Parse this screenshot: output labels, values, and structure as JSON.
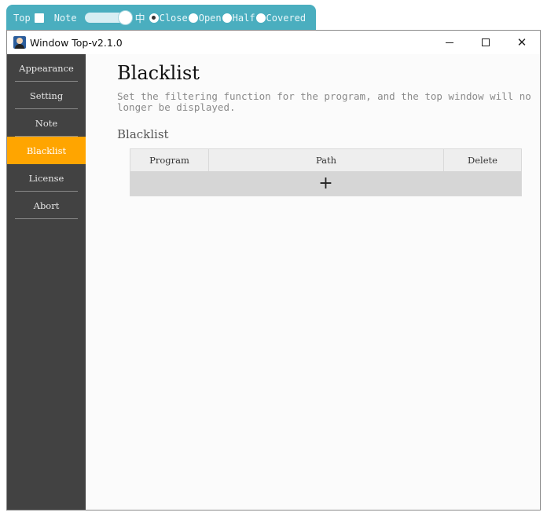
{
  "toolbar": {
    "top_label": "Top",
    "note_label": "Note",
    "lang_label": "中",
    "options": [
      {
        "label": "Close",
        "selected": true
      },
      {
        "label": "Open",
        "selected": false
      },
      {
        "label": "Half",
        "selected": false
      },
      {
        "label": "Covered",
        "selected": false
      }
    ]
  },
  "window": {
    "title": "Window Top-v2.1.0",
    "controls": {
      "minimize": "minimize",
      "maximize": "maximize",
      "close": "✕"
    }
  },
  "sidebar": {
    "items": [
      {
        "label": "Appearance",
        "active": false
      },
      {
        "label": "Setting",
        "active": false
      },
      {
        "label": "Note",
        "active": false
      },
      {
        "label": "Blacklist",
        "active": true
      },
      {
        "label": "License",
        "active": false
      },
      {
        "label": "Abort",
        "active": false
      }
    ]
  },
  "main": {
    "title": "Blacklist",
    "description": "Set the filtering function for the program, and the top window will no longer be displayed.",
    "section_title": "Blacklist",
    "table": {
      "columns": [
        "Program",
        "Path",
        "Delete"
      ],
      "rows": [],
      "add_symbol": "+"
    }
  },
  "colors": {
    "toolbar_bg": "#4aaebf",
    "sidebar_bg": "#424242",
    "accent": "#ffa500"
  }
}
